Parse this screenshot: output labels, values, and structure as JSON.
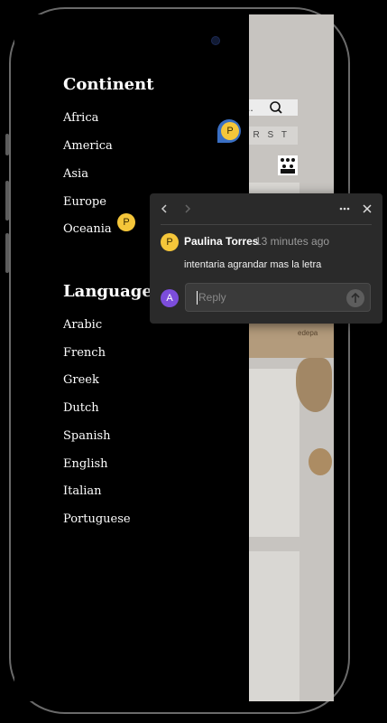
{
  "drawer": {
    "continent_title": "Continent",
    "continents": [
      "Africa",
      "America",
      "Asia",
      "Europe",
      "Oceania"
    ],
    "languages_title": "Languages",
    "languages": [
      "Arabic",
      "French",
      "Greek",
      "Dutch",
      "Spanish",
      "English",
      "Italian",
      "Portuguese"
    ]
  },
  "background_app": {
    "search_text": "ch...",
    "letters": "Q R S T",
    "map_text": "edepa"
  },
  "comment_markers": [
    {
      "initial": "P",
      "color": "#f5c63a"
    },
    {
      "initial": "P",
      "color": "#f5c63a"
    }
  ],
  "comment_popup": {
    "prev_icon": "chevron-left-icon",
    "next_icon": "chevron-right-icon",
    "more_icon": "more-horizontal-icon",
    "close_icon": "close-icon",
    "author_initial": "P",
    "author": "Paulina Torres",
    "time": "13 minutes ago",
    "text": "intentaria agrandar mas la letra",
    "reply_initial": "A",
    "reply_placeholder": "Reply",
    "send_icon": "arrow-up-icon"
  },
  "colors": {
    "avatar_yellow": "#f5c63a",
    "avatar_purple": "#7c4ddb",
    "popup_bg": "#2a2a2a",
    "marker_blue": "#3a6fc4"
  }
}
